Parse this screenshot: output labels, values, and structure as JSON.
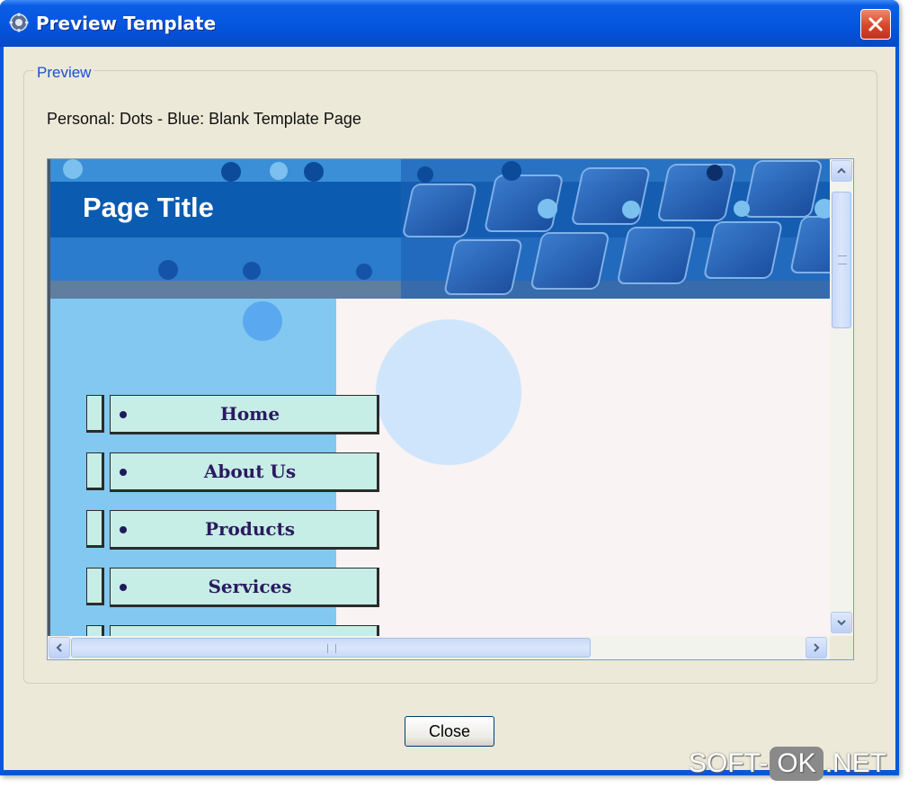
{
  "window": {
    "title": "Preview Template",
    "close_icon": "close-icon",
    "title_icon": "gear-icon"
  },
  "group": {
    "label": "Preview"
  },
  "template": {
    "name": "Personal: Dots - Blue: Blank Template Page"
  },
  "preview_page": {
    "title": "Page Title",
    "nav_items": [
      "Home",
      "About Us",
      "Products",
      "Services"
    ],
    "colors": {
      "banner": "#0b5bb0",
      "sidebar": "#82c8f0",
      "nav_button": "#c6eee6",
      "content": "#f9f3f3"
    }
  },
  "buttons": {
    "close_label": "Close"
  },
  "watermark": {
    "left": "SOFT-",
    "box": "OK",
    "right": ".NET"
  }
}
